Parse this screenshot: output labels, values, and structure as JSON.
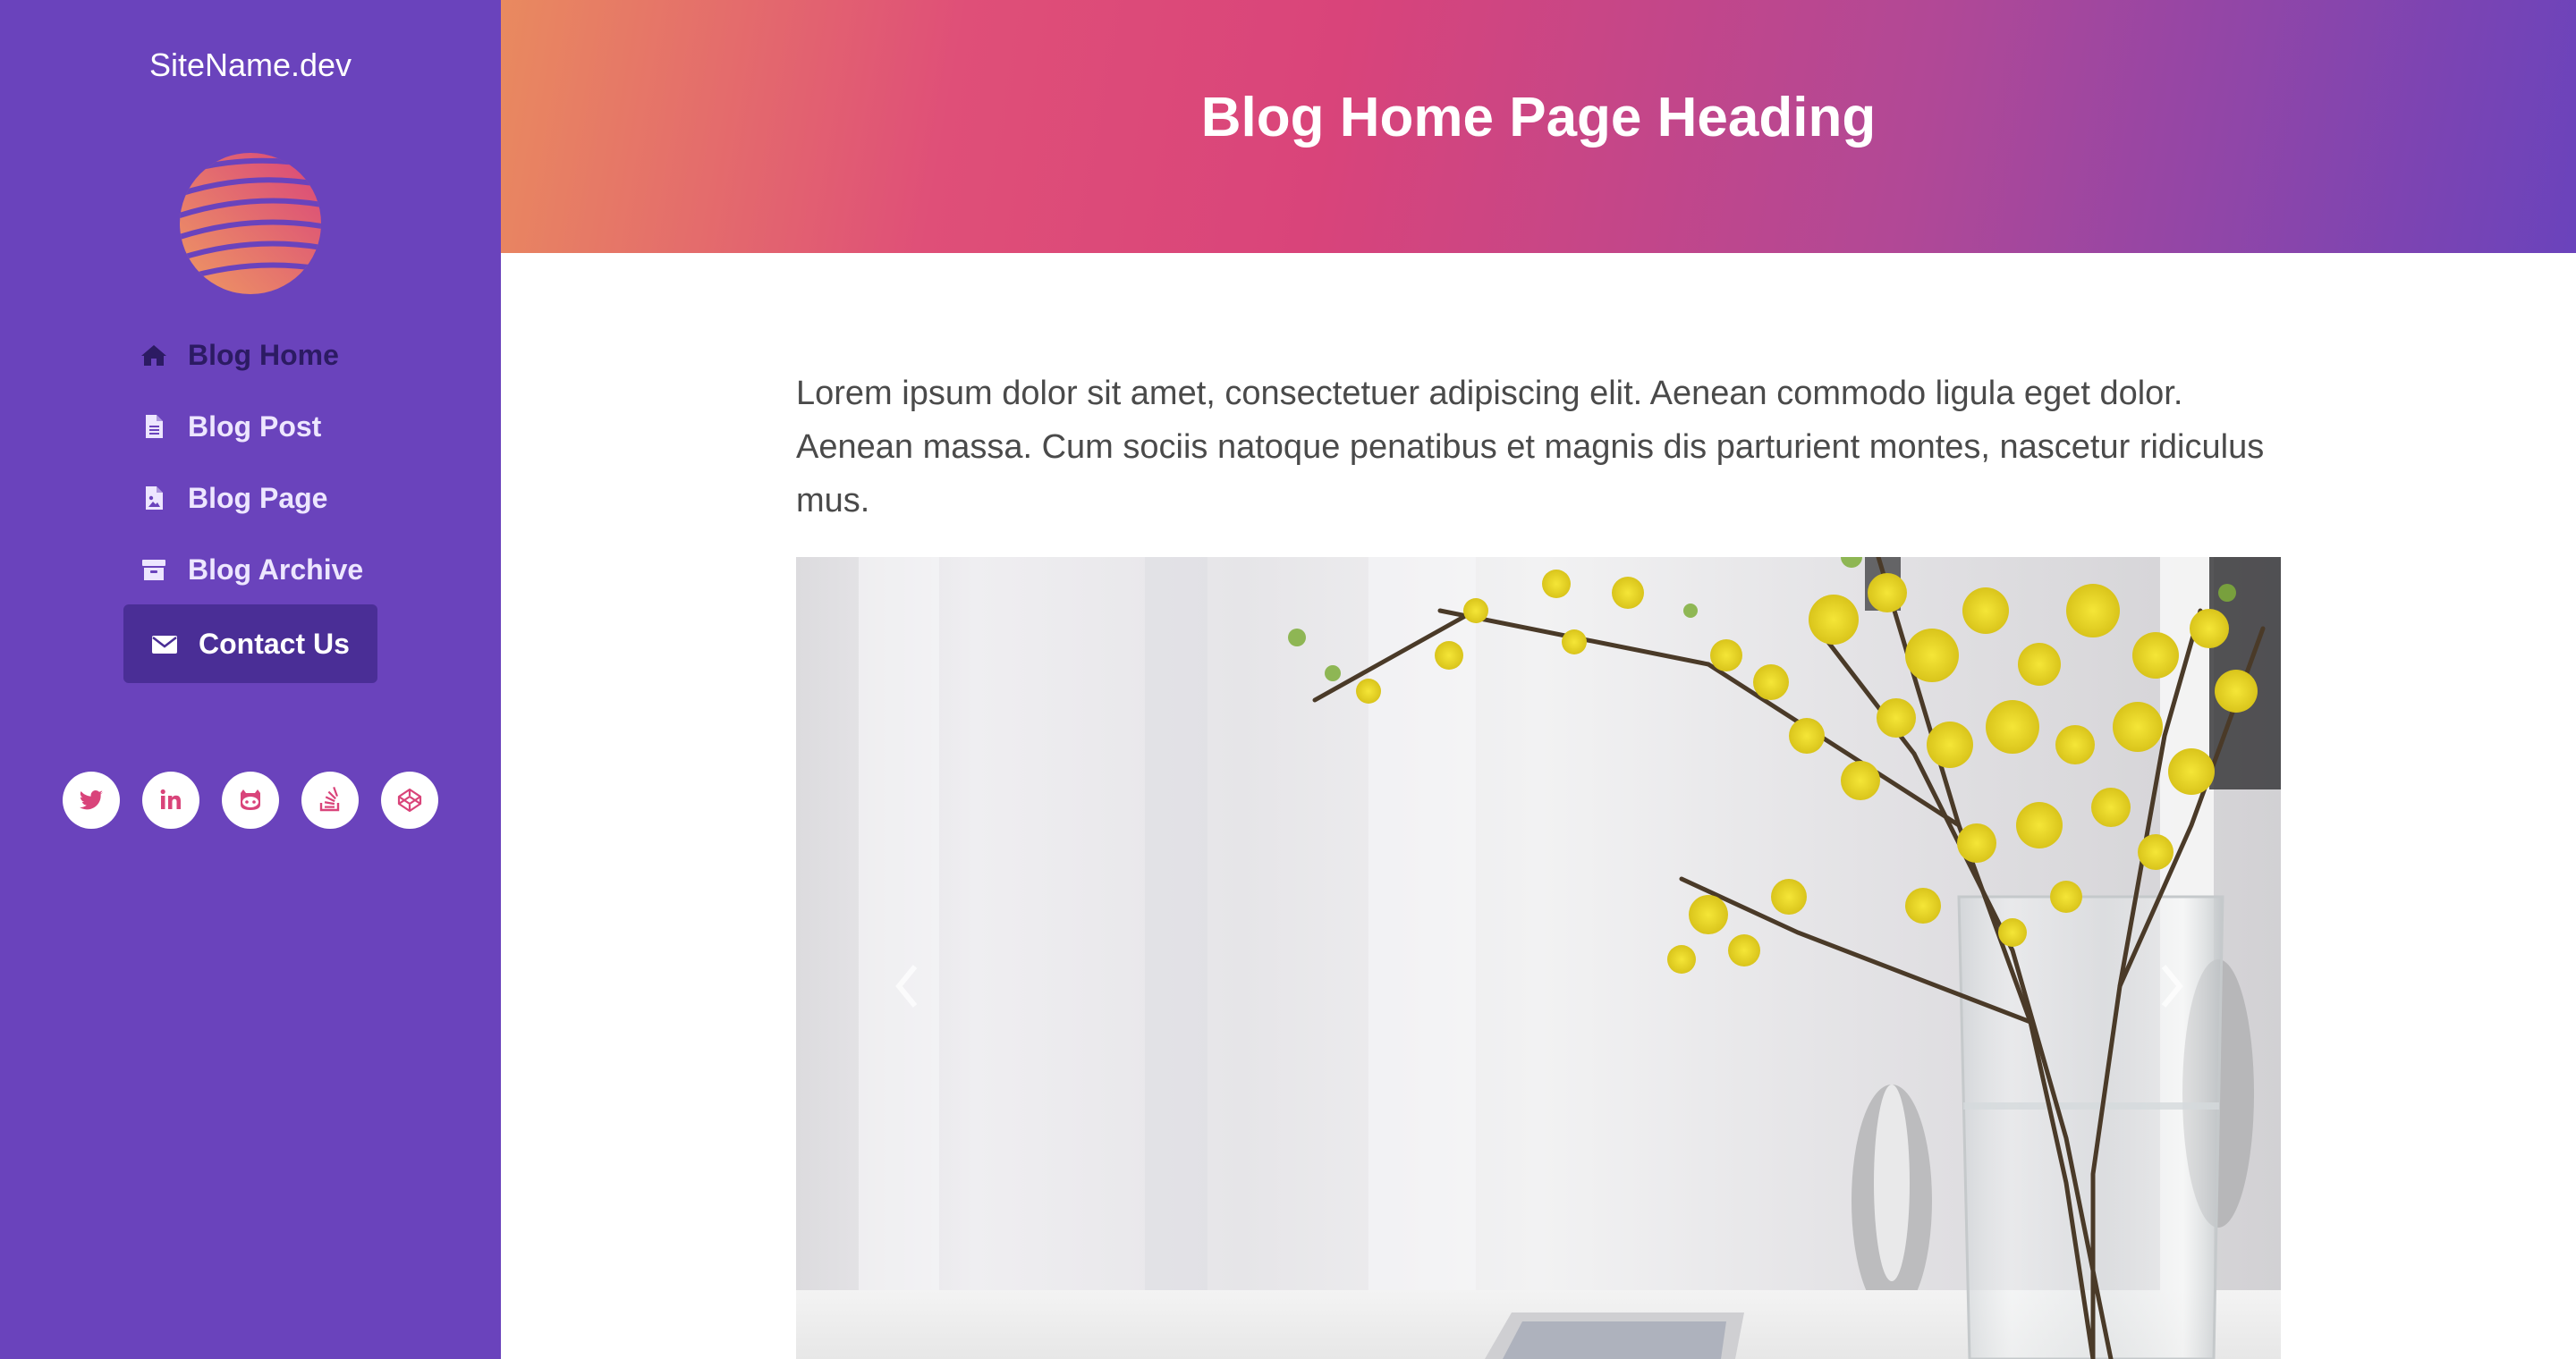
{
  "sidebar": {
    "site_name": "SiteName.dev",
    "logo": {
      "icon": "striped-globe-logo",
      "colors": [
        "#e98a5f",
        "#df4f78"
      ]
    },
    "nav": [
      {
        "label": "Blog Home",
        "icon": "home-icon",
        "state": "active"
      },
      {
        "label": "Blog Post",
        "icon": "file-text-icon",
        "state": "default"
      },
      {
        "label": "Blog Page",
        "icon": "file-image-icon",
        "state": "default"
      },
      {
        "label": "Blog Archive",
        "icon": "archive-icon",
        "state": "default"
      },
      {
        "label": "Contact Us",
        "icon": "envelope-icon",
        "state": "highlighted"
      }
    ],
    "social": [
      {
        "icon": "twitter-icon"
      },
      {
        "icon": "linkedin-icon"
      },
      {
        "icon": "github-icon"
      },
      {
        "icon": "stack-overflow-icon"
      },
      {
        "icon": "codepen-icon"
      }
    ],
    "colors": {
      "background": "#6a43bc",
      "highlight": "#4a2e96",
      "social_icon": "#d9447a"
    }
  },
  "header": {
    "title": "Blog Home Page Heading",
    "gradient": [
      "#e98a5f",
      "#d9447a",
      "#6a43bc"
    ]
  },
  "main": {
    "intro": "Lorem ipsum dolor sit amet, consectetuer adipiscing elit. Aenean commodo ligula eget dolor. Aenean massa. Cum sociis natoque penatibus et magnis dis parturient montes, nascetur ridiculus mus.",
    "carousel": {
      "image": "yellow-forsythia-flowers-in-glass-vase",
      "prev_icon": "chevron-left-icon",
      "next_icon": "chevron-right-icon"
    }
  }
}
